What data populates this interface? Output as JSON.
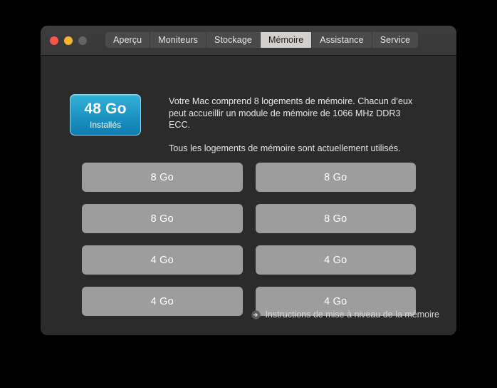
{
  "window": {
    "traffic_lights": [
      {
        "name": "close",
        "color": "#f9564a"
      },
      {
        "name": "minimize",
        "color": "#f9b32f"
      },
      {
        "name": "zoom",
        "color": "#646464"
      }
    ],
    "tabs": [
      {
        "label": "Aperçu",
        "selected": false
      },
      {
        "label": "Moniteurs",
        "selected": false
      },
      {
        "label": "Stockage",
        "selected": false
      },
      {
        "label": "Mémoire",
        "selected": true
      },
      {
        "label": "Assistance",
        "selected": false
      },
      {
        "label": "Service",
        "selected": false
      }
    ]
  },
  "badge": {
    "amount": "48 Go",
    "caption": "Installés",
    "gradient_top": "#34b2d8",
    "gradient_bottom": "#0e7cb0",
    "border_color": "#8fd2e8"
  },
  "description": {
    "paragraph1": "Votre Mac comprend 8 logements de mémoire. Chacun d’eux peut accueillir un module de mémoire de 1066 MHz DDR3 ECC.",
    "paragraph2": "Tous les logements de mémoire sont actuellement utilisés."
  },
  "slots": [
    {
      "label": "8 Go"
    },
    {
      "label": "8 Go"
    },
    {
      "label": "8 Go"
    },
    {
      "label": "8 Go"
    },
    {
      "label": "4 Go"
    },
    {
      "label": "4 Go"
    },
    {
      "label": "4 Go"
    },
    {
      "label": "4 Go"
    }
  ],
  "slot_color": "#9d9d9d",
  "upgrade_link": {
    "icon": "arrow-right-circle-icon",
    "label": "Instructions de mise à niveau de la mémoire"
  }
}
